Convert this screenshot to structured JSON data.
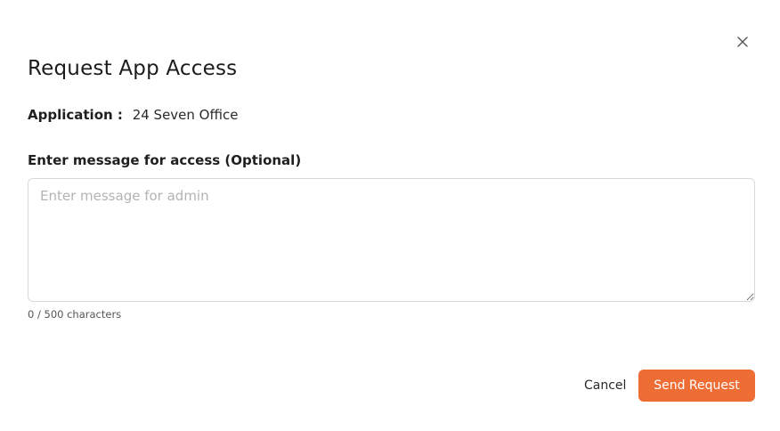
{
  "dialog": {
    "title": "Request App Access",
    "close_icon": "close-icon"
  },
  "application": {
    "label": "Application :",
    "value": "24 Seven Office"
  },
  "message": {
    "label": "Enter message for access (Optional)",
    "placeholder": "Enter message for admin",
    "value": "",
    "char_count": "0 / 500 characters"
  },
  "actions": {
    "cancel_label": "Cancel",
    "send_label": "Send Request"
  },
  "colors": {
    "accent": "#ee6d35",
    "border": "#d9d9d9",
    "placeholder": "#b3b3b3"
  }
}
